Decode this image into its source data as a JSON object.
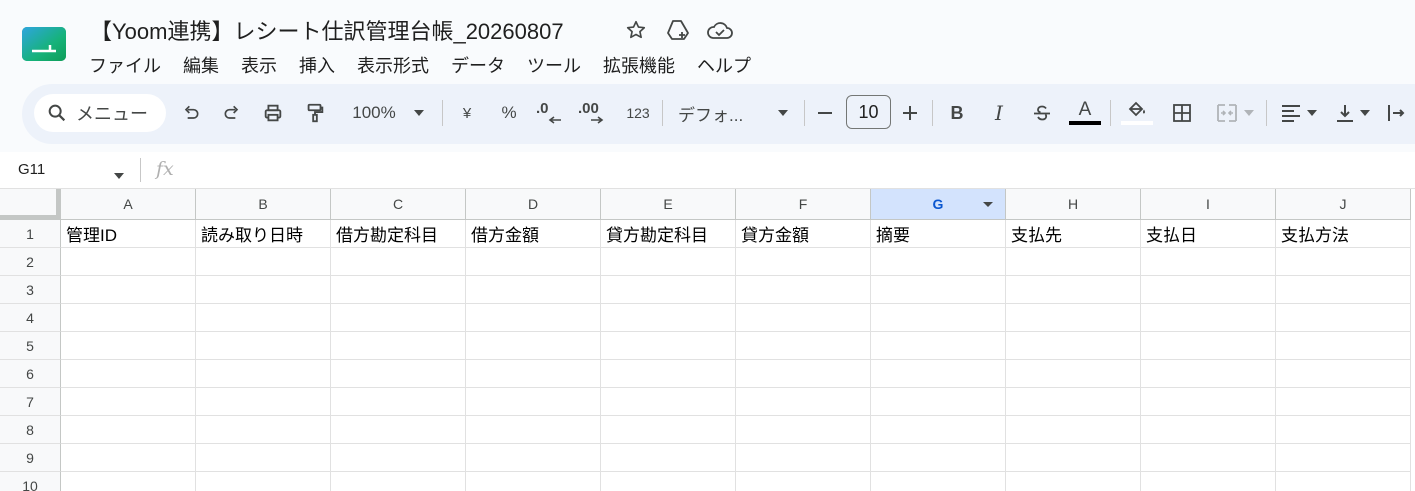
{
  "app": {
    "doc_title": "【Yoom連携】レシート仕訳管理台帳_20260807",
    "title_icons": [
      "star-icon",
      "move-to-drive-icon",
      "cloud-saved-icon"
    ],
    "menu": [
      "ファイル",
      "編集",
      "表示",
      "挿入",
      "表示形式",
      "データ",
      "ツール",
      "拡張機能",
      "ヘルプ"
    ]
  },
  "toolbar": {
    "search_label": "メニュー",
    "zoom": "100%",
    "currency": "¥",
    "percent": "%",
    "dec_decrease": ".0",
    "dec_increase": ".00",
    "number_format": "123",
    "font": "デフォ...",
    "font_size": "10",
    "text_color": "#000000"
  },
  "formula_bar": {
    "cell_ref": "G11",
    "fx": "fx",
    "value": ""
  },
  "sheet": {
    "columns": [
      "A",
      "B",
      "C",
      "D",
      "E",
      "F",
      "G",
      "H",
      "I",
      "J"
    ],
    "selected_column": "G",
    "rows": [
      "1",
      "2",
      "3",
      "4",
      "5",
      "6",
      "7",
      "8",
      "9",
      "10"
    ],
    "header_cells": [
      "管理ID",
      "読み取り日時",
      "借方勘定科目",
      "借方金額",
      "貸方勘定科目",
      "貸方金額",
      "摘要",
      "支払先",
      "支払日",
      "支払方法"
    ]
  }
}
